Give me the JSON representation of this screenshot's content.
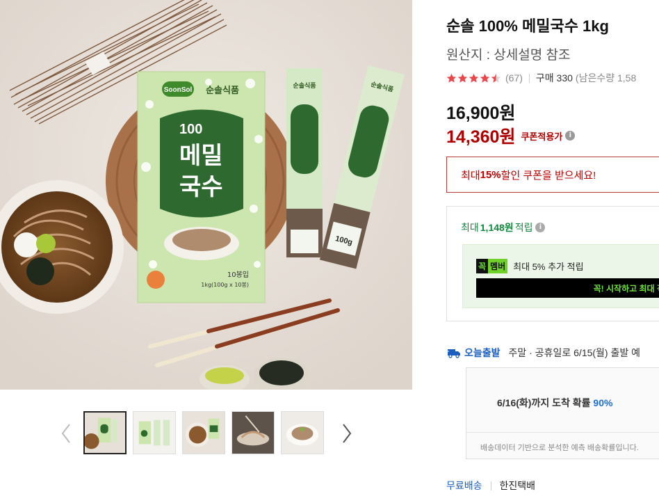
{
  "product": {
    "title": "순솔 100% 메밀국수 1kg",
    "origin": "원산지 : 상세설명 참조",
    "rating": 4.5,
    "review_count": "(67)",
    "purchase_count": "구매 330",
    "remaining_stock": "(남은수량 1,58"
  },
  "price": {
    "original": "16,900원",
    "sale": "14,360원",
    "coupon_tag": "쿠폰적용가",
    "info_glyph": "i"
  },
  "coupon": {
    "prefix": "최대 ",
    "percent": "15%",
    "suffix": " 할인 쿠폰을 받으세요!"
  },
  "reward": {
    "prefix": "최대",
    "amount": "1,148원",
    "suffix": "적립",
    "member_badge_a": "꼭",
    "member_badge_b": "멤버",
    "member_text": "최대 5% 추가 적립",
    "member_cta": "꼭! 시작하고 최대 적립"
  },
  "shipping": {
    "badge": "오늘출발",
    "text": "주말 · 공휴일로 6/15(월) 출발 예",
    "predict_prefix": "6/16(화)까지 도착 확률 ",
    "predict_percent": "90%",
    "predict_note": "배송데이터 기반으로 분석한 예측 배송확률입니다.",
    "free_label": "무료배송",
    "courier": "한진택배"
  },
  "package_text": {
    "brand_logo": "SoonSol",
    "brand_kr": "순솔식품",
    "percent": "100",
    "name_line1": "메밀",
    "name_line2": "국수",
    "count": "10봉입",
    "weight": "1kg(100g x 10봉)",
    "stick_brand": "순솔식품",
    "stick_weight": "100g"
  },
  "gallery": {
    "thumbnails": [
      "thumb-main",
      "thumb-packs",
      "thumb-bowl",
      "thumb-cooking",
      "thumb-plate"
    ],
    "active_index": 0
  },
  "colors": {
    "price_red": "#ae0000",
    "reward_green": "#11883c",
    "link_blue": "#1a5fbf",
    "package_green": "#cde6b0",
    "member_green": "#6fe23a"
  },
  "icons": [
    "star-icon",
    "info-icon",
    "truck-icon",
    "chevron-left-icon",
    "chevron-right-icon"
  ]
}
